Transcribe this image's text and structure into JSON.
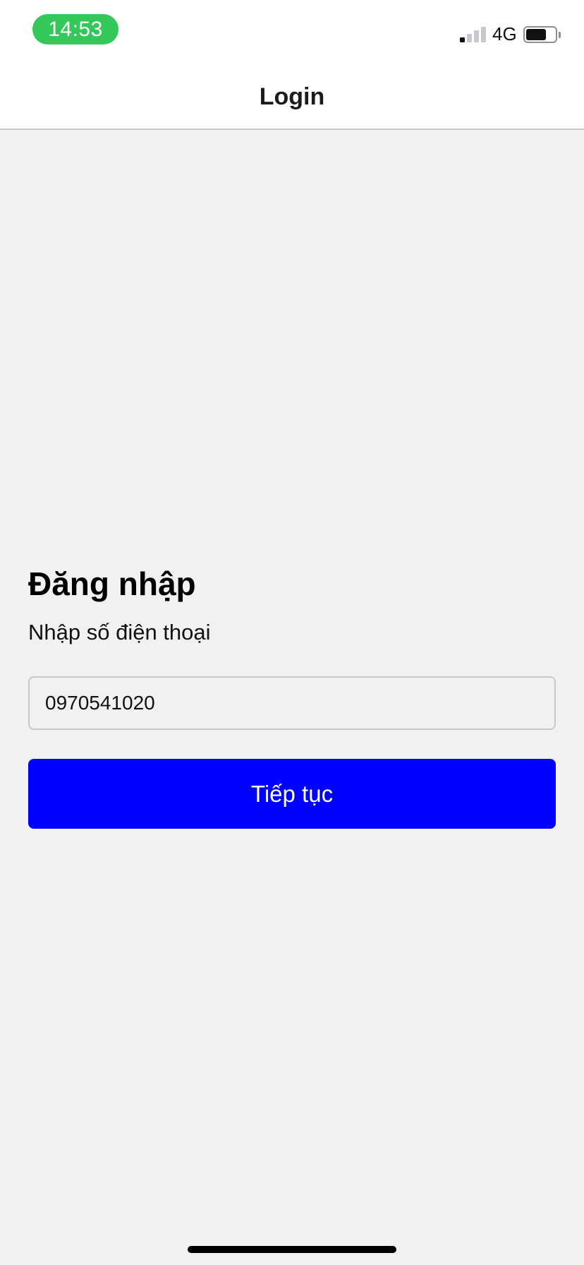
{
  "status_bar": {
    "time": "14:53",
    "network": "4G",
    "signal_bars_active": 1,
    "signal_bars_total": 4,
    "battery_level": 0.7,
    "time_pill_color": "#34c759"
  },
  "nav": {
    "title": "Login"
  },
  "login": {
    "heading": "Đăng nhập",
    "subheading": "Nhập số điện thoại",
    "phone_value": "0970541020",
    "continue_label": "Tiếp tục",
    "button_color": "#0000ff"
  }
}
